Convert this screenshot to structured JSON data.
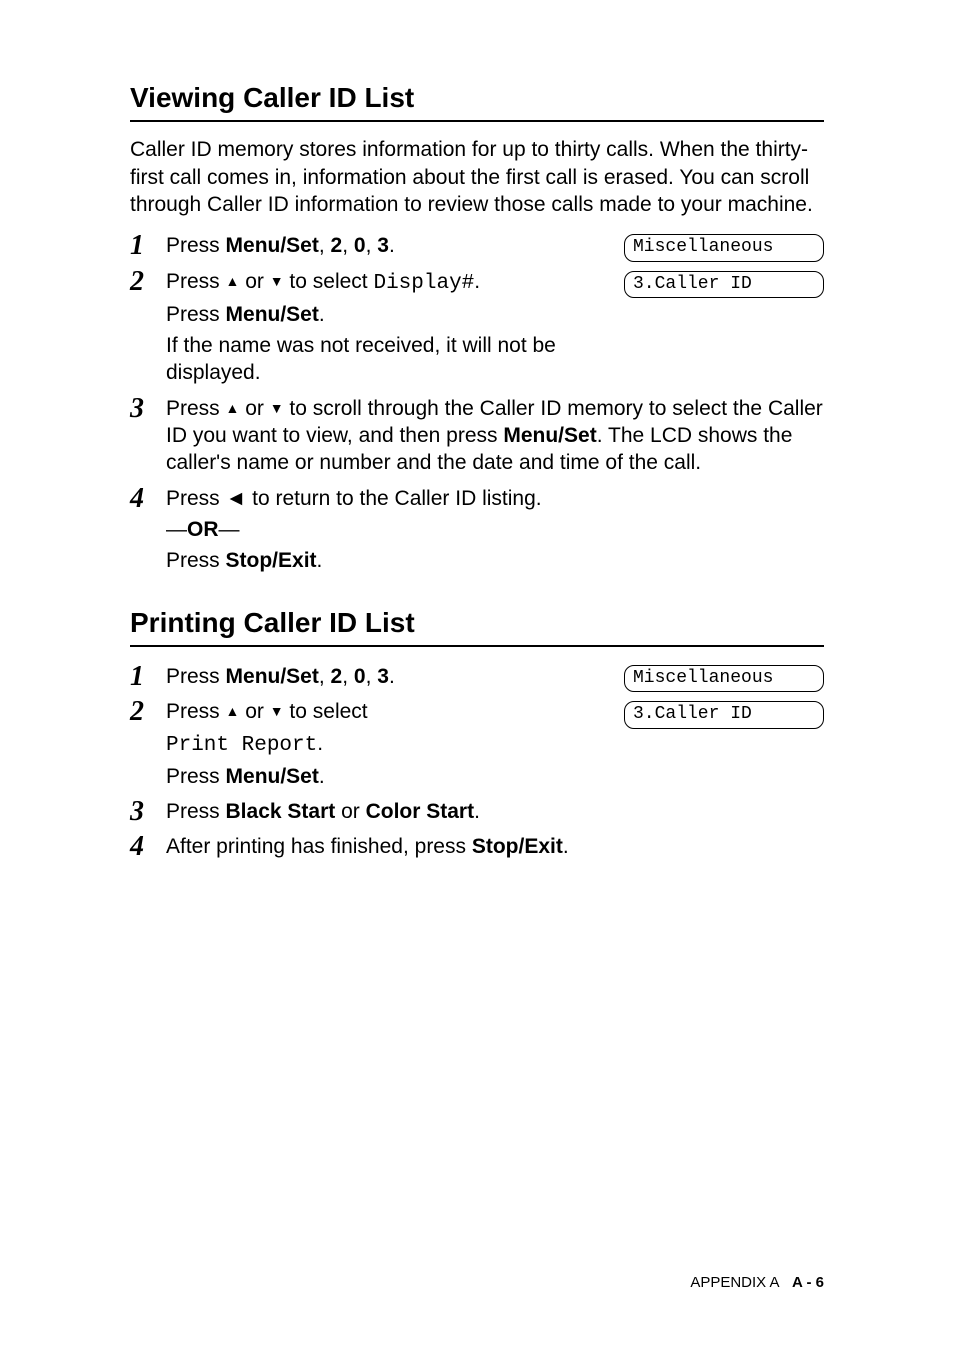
{
  "section1": {
    "title": "Viewing Caller ID List",
    "intro": "Caller ID memory stores information for up to thirty calls. When the thirty-first call comes in, information about the first call is erased. You can scroll through Caller ID information to review those calls made to your machine.",
    "lcd1": "Miscellaneous",
    "lcd2": "3.Caller ID",
    "step1": {
      "prefix": "Press ",
      "menu": "Menu/Set",
      "s2": "2",
      "s0": "0",
      "s3": "3"
    },
    "step2": {
      "l1a": "Press ",
      "l1b": " or ",
      "l1c": " to select ",
      "l1d": "Display#",
      "l2a": "Press ",
      "l2b": "Menu/Set",
      "l3": "If the name was not received, it will not be displayed."
    },
    "step3": {
      "a": "Press ",
      "b": " or ",
      "c": " to scroll through the Caller ID memory to select the Caller ID you want to view, and then press ",
      "d": "Menu/Set",
      "e": ". The LCD shows the caller's name or number and the date and time of the call."
    },
    "step4": {
      "a": "Press  ◄  to return to the Caller ID listing.",
      "or1": "—",
      "orb": "OR",
      "or2": "—",
      "pa": "Press ",
      "pb": "Stop/Exit",
      "pc": "."
    }
  },
  "section2": {
    "title": "Printing Caller ID List",
    "lcd1": "Miscellaneous",
    "lcd2": "3.Caller ID",
    "step1": {
      "prefix": "Press ",
      "menu": "Menu/Set",
      "s2": "2",
      "s0": "0",
      "s3": "3"
    },
    "step2": {
      "l1a": "Press ",
      "l1b": " or ",
      "l1c": " to select",
      "l2a": "Print Report",
      "l2b": ".",
      "l3a": "Press ",
      "l3b": "Menu/Set",
      "l3c": "."
    },
    "step3": {
      "a": "Press ",
      "b": "Black Start",
      "c": " or ",
      "d": "Color Start",
      "e": "."
    },
    "step4": {
      "a": "After printing has finished, press ",
      "b": "Stop/Exit",
      "c": "."
    }
  },
  "footer": {
    "appendix": "APPENDIX A",
    "page": "A - 6"
  }
}
